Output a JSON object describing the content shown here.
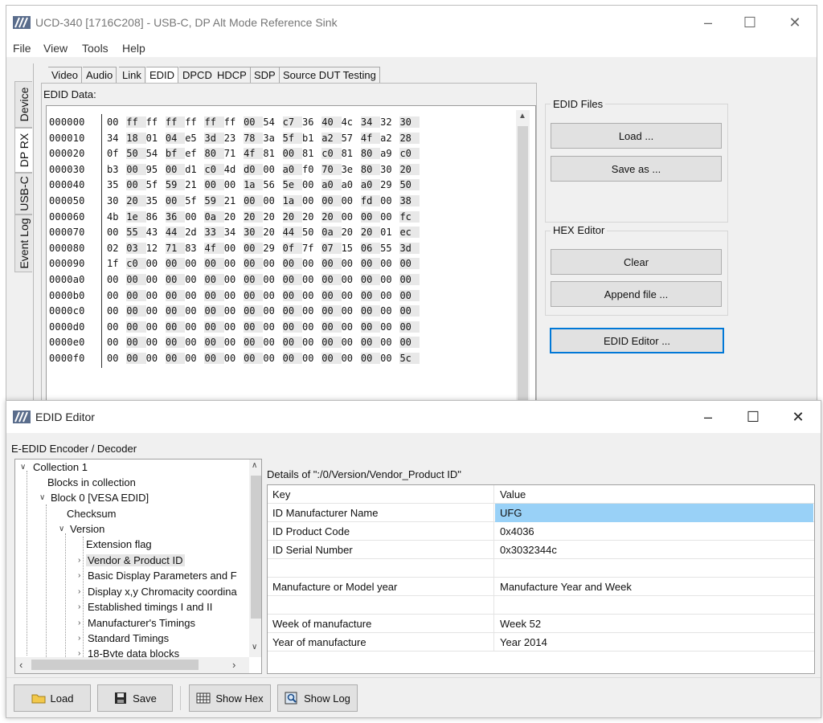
{
  "main_window": {
    "title": "UCD-340 [1716C208] - USB-C, DP Alt Mode Reference Sink",
    "menu": [
      "File",
      "View",
      "Tools",
      "Help"
    ],
    "side_tabs": [
      "Device",
      "DP RX",
      "USB-C",
      "Event Log"
    ],
    "active_side_tab": "DP RX",
    "top_tabs": [
      "Video",
      "Audio",
      "Link",
      "EDID",
      "DPCD",
      "HDCP",
      "SDP",
      "Source DUT Testing"
    ],
    "active_top_tab": "EDID",
    "edid_label": "EDID Data:",
    "hex_rows": [
      {
        "addr": "000000",
        "bytes": [
          "00",
          "ff",
          "ff",
          "ff",
          "ff",
          "ff",
          "ff",
          "00",
          "54",
          "c7",
          "36",
          "40",
          "4c",
          "34",
          "32",
          "30"
        ]
      },
      {
        "addr": "000010",
        "bytes": [
          "34",
          "18",
          "01",
          "04",
          "e5",
          "3d",
          "23",
          "78",
          "3a",
          "5f",
          "b1",
          "a2",
          "57",
          "4f",
          "a2",
          "28"
        ]
      },
      {
        "addr": "000020",
        "bytes": [
          "0f",
          "50",
          "54",
          "bf",
          "ef",
          "80",
          "71",
          "4f",
          "81",
          "00",
          "81",
          "c0",
          "81",
          "80",
          "a9",
          "c0"
        ]
      },
      {
        "addr": "000030",
        "bytes": [
          "b3",
          "00",
          "95",
          "00",
          "d1",
          "c0",
          "4d",
          "d0",
          "00",
          "a0",
          "f0",
          "70",
          "3e",
          "80",
          "30",
          "20"
        ]
      },
      {
        "addr": "000040",
        "bytes": [
          "35",
          "00",
          "5f",
          "59",
          "21",
          "00",
          "00",
          "1a",
          "56",
          "5e",
          "00",
          "a0",
          "a0",
          "a0",
          "29",
          "50"
        ]
      },
      {
        "addr": "000050",
        "bytes": [
          "30",
          "20",
          "35",
          "00",
          "5f",
          "59",
          "21",
          "00",
          "00",
          "1a",
          "00",
          "00",
          "00",
          "fd",
          "00",
          "38"
        ]
      },
      {
        "addr": "000060",
        "bytes": [
          "4b",
          "1e",
          "86",
          "36",
          "00",
          "0a",
          "20",
          "20",
          "20",
          "20",
          "20",
          "20",
          "00",
          "00",
          "00",
          "fc"
        ]
      },
      {
        "addr": "000070",
        "bytes": [
          "00",
          "55",
          "43",
          "44",
          "2d",
          "33",
          "34",
          "30",
          "20",
          "44",
          "50",
          "0a",
          "20",
          "20",
          "01",
          "ec"
        ]
      },
      {
        "addr": "000080",
        "bytes": [
          "02",
          "03",
          "12",
          "71",
          "83",
          "4f",
          "00",
          "00",
          "29",
          "0f",
          "7f",
          "07",
          "15",
          "06",
          "55",
          "3d"
        ]
      },
      {
        "addr": "000090",
        "bytes": [
          "1f",
          "c0",
          "00",
          "00",
          "00",
          "00",
          "00",
          "00",
          "00",
          "00",
          "00",
          "00",
          "00",
          "00",
          "00",
          "00"
        ]
      },
      {
        "addr": "0000a0",
        "bytes": [
          "00",
          "00",
          "00",
          "00",
          "00",
          "00",
          "00",
          "00",
          "00",
          "00",
          "00",
          "00",
          "00",
          "00",
          "00",
          "00"
        ]
      },
      {
        "addr": "0000b0",
        "bytes": [
          "00",
          "00",
          "00",
          "00",
          "00",
          "00",
          "00",
          "00",
          "00",
          "00",
          "00",
          "00",
          "00",
          "00",
          "00",
          "00"
        ]
      },
      {
        "addr": "0000c0",
        "bytes": [
          "00",
          "00",
          "00",
          "00",
          "00",
          "00",
          "00",
          "00",
          "00",
          "00",
          "00",
          "00",
          "00",
          "00",
          "00",
          "00"
        ]
      },
      {
        "addr": "0000d0",
        "bytes": [
          "00",
          "00",
          "00",
          "00",
          "00",
          "00",
          "00",
          "00",
          "00",
          "00",
          "00",
          "00",
          "00",
          "00",
          "00",
          "00"
        ]
      },
      {
        "addr": "0000e0",
        "bytes": [
          "00",
          "00",
          "00",
          "00",
          "00",
          "00",
          "00",
          "00",
          "00",
          "00",
          "00",
          "00",
          "00",
          "00",
          "00",
          "00"
        ]
      },
      {
        "addr": "0000f0",
        "bytes": [
          "00",
          "00",
          "00",
          "00",
          "00",
          "00",
          "00",
          "00",
          "00",
          "00",
          "00",
          "00",
          "00",
          "00",
          "00",
          "5c"
        ]
      }
    ],
    "edid_files": {
      "title": "EDID Files",
      "load": "Load ...",
      "save_as": "Save as ..."
    },
    "hex_editor": {
      "title": "HEX Editor",
      "clear": "Clear",
      "append": "Append file ..."
    },
    "edid_editor_button": "EDID Editor ..."
  },
  "editor_window": {
    "title": "EDID Editor",
    "section_label": "E-EDID Encoder / Decoder",
    "tree": [
      {
        "label": "Collection 1"
      },
      {
        "label": "Blocks in collection"
      },
      {
        "label": "Block 0 [VESA EDID]"
      },
      {
        "label": "Checksum"
      },
      {
        "label": "Version"
      },
      {
        "label": "Extension flag"
      },
      {
        "label": "Vendor & Product ID"
      },
      {
        "label": "Basic Display Parameters and F"
      },
      {
        "label": "Display x,y Chromacity coordina"
      },
      {
        "label": "Established timings I and II"
      },
      {
        "label": "Manufacturer's Timings"
      },
      {
        "label": "Standard Timings"
      },
      {
        "label": "18-Byte data blocks"
      }
    ],
    "details_label": "Details of \":/0/Version/Vendor_Product ID\"",
    "table_headers": {
      "key": "Key",
      "value": "Value"
    },
    "rows": [
      {
        "key": "ID Manufacturer Name",
        "value": "UFG"
      },
      {
        "key": "ID Product Code",
        "value": "0x4036"
      },
      {
        "key": "ID Serial Number",
        "value": "0x3032344c"
      },
      {
        "key": "",
        "value": ""
      },
      {
        "key": "Manufacture or Model year",
        "value": "Manufacture Year and Week"
      },
      {
        "key": "",
        "value": ""
      },
      {
        "key": "Week of manufacture",
        "value": "Week 52"
      },
      {
        "key": "Year of manufacture",
        "value": "Year 2014"
      }
    ],
    "toolbar": {
      "load": "Load",
      "save": "Save",
      "show_hex": "Show Hex",
      "show_log": "Show Log"
    }
  },
  "colors": {
    "selection": "#99d1f7",
    "focus_border": "#0078d7",
    "window_bg": "#f0f0f0"
  }
}
